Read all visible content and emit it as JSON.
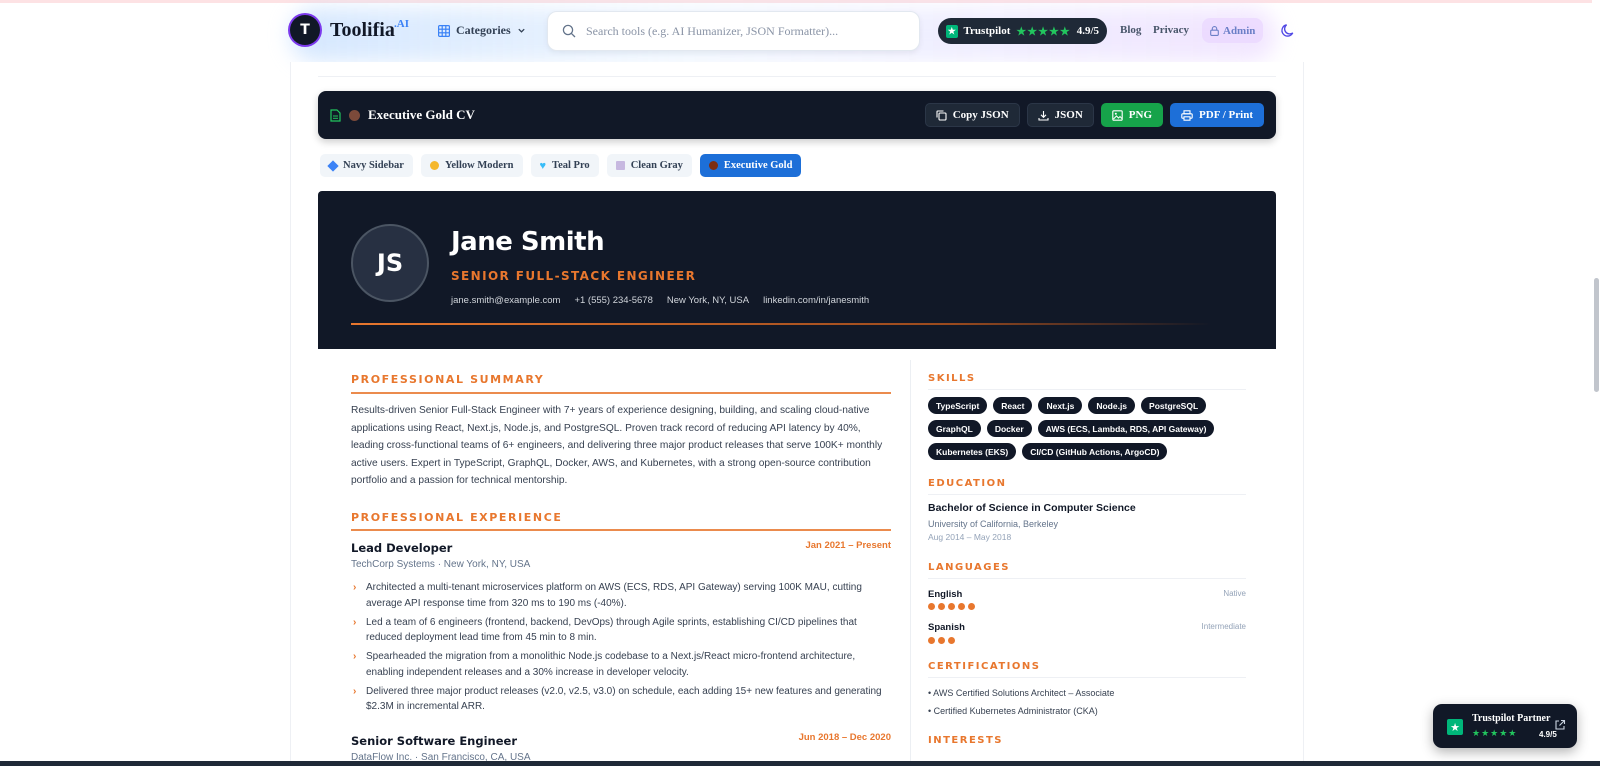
{
  "site": {
    "logo_mark": "T",
    "logo_text": "Toolifia",
    "logo_sup": ".AI",
    "categories_label": "Categories",
    "search_placeholder": "Search tools (e.g. AI Humanizer, JSON Formatter)...",
    "trustpilot_label": "Trustpilot",
    "trustpilot_stars": "★★★★★",
    "trustpilot_score": "4.9/5",
    "nav": {
      "blog": "Blog",
      "privacy": "Privacy",
      "admin": "Admin"
    },
    "colors": {
      "accent": "#e8772e",
      "dark": "#111827",
      "primary_blue": "#1d6fd8",
      "green": "#16a34a",
      "trustpilot_green": "#00b67a"
    }
  },
  "toolbar": {
    "title": "Executive Gold CV",
    "copy_json": "Copy JSON",
    "json": "JSON",
    "png": "PNG",
    "pdf": "PDF / Print"
  },
  "templates": [
    {
      "label": "Navy Sidebar",
      "icon": "blue-diamond-icon",
      "color": "#3b82f6",
      "active": false
    },
    {
      "label": "Yellow Modern",
      "icon": "yellow-circle-icon",
      "color": "#f5b82e",
      "active": false
    },
    {
      "label": "Teal Pro",
      "icon": "teal-heart-icon",
      "color": "#38bdf8",
      "active": false
    },
    {
      "label": "Clean Gray",
      "icon": "gray-square-icon",
      "color": "#c7b8e0",
      "active": false
    },
    {
      "label": "Executive Gold",
      "icon": "brown-circle-icon",
      "color": "#7c2d12",
      "active": true
    }
  ],
  "cv": {
    "initials": "JS",
    "name": "Jane Smith",
    "role": "SENIOR FULL-STACK ENGINEER",
    "contacts": {
      "email": "jane.smith@example.com",
      "phone": "+1 (555) 234-5678",
      "location": "New York, NY, USA",
      "linkedin": "linkedin.com/in/janesmith"
    },
    "summary_heading": "PROFESSIONAL SUMMARY",
    "summary": "Results-driven Senior Full-Stack Engineer with 7+ years of experience designing, building, and scaling cloud-native applications using React, Next.js, Node.js, and PostgreSQL. Proven track record of reducing API latency by 40%, leading cross-functional teams of 6+ engineers, and delivering three major product releases that serve 100K+ monthly active users. Expert in TypeScript, GraphQL, Docker, AWS, and Kubernetes, with a strong open-source contribution portfolio and a passion for technical mentorship.",
    "experience_heading": "PROFESSIONAL EXPERIENCE",
    "jobs": [
      {
        "title": "Lead Developer",
        "company": "TechCorp Systems · New York, NY, USA",
        "dates": "Jan 2021 – Present",
        "bullets": [
          "Architected a multi-tenant microservices platform on AWS (ECS, RDS, API Gateway) serving 100K MAU, cutting average API response time from 320 ms to 190 ms (-40%).",
          "Led a team of 6 engineers (frontend, backend, DevOps) through Agile sprints, establishing CI/CD pipelines that reduced deployment lead time from 45 min to 8 min.",
          "Spearheaded the migration from a monolithic Node.js codebase to a Next.js/React micro-frontend architecture, enabling independent releases and a 30% increase in developer velocity.",
          "Delivered three major product releases (v2.0, v2.5, v3.0) on schedule, each adding 15+ new features and generating $2.3M in incremental ARR."
        ]
      },
      {
        "title": "Senior Software Engineer",
        "company": "DataFlow Inc. · San Francisco, CA, USA",
        "dates": "Jun 2018 – Dec 2020"
      }
    ],
    "skills_heading": "SKILLS",
    "skills": [
      "TypeScript",
      "React",
      "Next.js",
      "Node.js",
      "PostgreSQL",
      "GraphQL",
      "Docker",
      "AWS (ECS, Lambda, RDS, API Gateway)",
      "Kubernetes (EKS)",
      "CI/CD (GitHub Actions, ArgoCD)"
    ],
    "education_heading": "EDUCATION",
    "education": {
      "degree": "Bachelor of Science in Computer Science",
      "school": "University of California, Berkeley",
      "dates": "Aug 2014 – May 2018"
    },
    "languages_heading": "LANGUAGES",
    "languages": [
      {
        "name": "English",
        "level": "Native",
        "dots": 5
      },
      {
        "name": "Spanish",
        "level": "Intermediate",
        "dots": 3
      }
    ],
    "certifications_heading": "CERTIFICATIONS",
    "certifications": [
      "• AWS Certified Solutions Architect – Associate",
      "• Certified Kubernetes Administrator (CKA)"
    ],
    "interests_heading": "INTERESTS"
  },
  "partner_badge": {
    "title": "Trustpilot Partner",
    "stars": "★★★★★",
    "score": "4.9/5"
  }
}
